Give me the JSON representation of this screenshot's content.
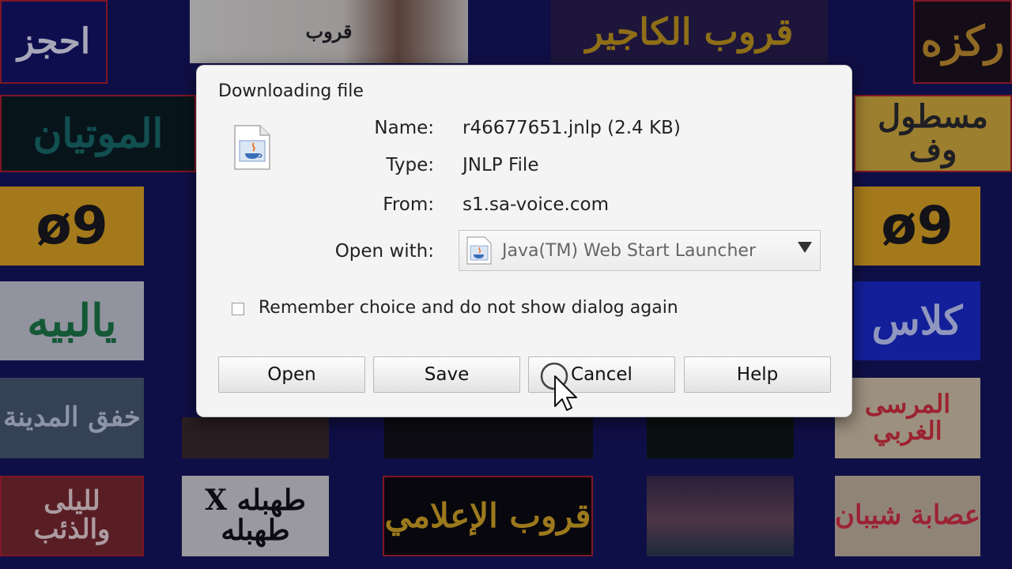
{
  "background_tiles": [
    {
      "text": "احجز",
      "color": "#e8e8f8",
      "bg": "#141466"
    },
    {
      "text": "قروب",
      "color": "#222222",
      "bg": "#d9d6cc"
    },
    {
      "text": "قروب الكاجير",
      "color": "#c59a18",
      "bg": "#2a1e4a"
    },
    {
      "text": "ركزه",
      "color": "#c8932a",
      "bg": "#1c1218"
    },
    {
      "text": "الموتيان",
      "color": "#1a6e68",
      "bg": "#0a1e1e"
    },
    {
      "text": "مسطول وف",
      "color": "#2a2a2a",
      "bg": "#d8b03a"
    },
    {
      "text": "ø9",
      "color": "#1a1a1a",
      "bg": "#e3a81e"
    },
    {
      "text": "ø9",
      "color": "#1a1a1a",
      "bg": "#e3a81e"
    },
    {
      "text": "يالبيه",
      "color": "#1d7a42",
      "bg": "#c9ccd4"
    },
    {
      "text": "كلاس",
      "color": "#c8d2ff",
      "bg": "#1a2ccc"
    },
    {
      "text": "خفق المدينة",
      "color": "#c4cde0",
      "bg": "#4a5a6e"
    },
    {
      "text": "المرسى الغربي",
      "color": "#d8303a",
      "bg": "#d8c8a8"
    },
    {
      "text": "لليلى والذئب",
      "color": "#f0d8d8",
      "bg": "#7a2a2a"
    },
    {
      "text": "طهبله X طهبله",
      "color": "#111111",
      "bg": "#d4d4d4"
    },
    {
      "text": "قروب الإعلامي",
      "color": "#d8a820",
      "bg": "#0a0a0a"
    },
    {
      "text": "عصابة شيبان",
      "color": "#d83040",
      "bg": "#c8b8a0"
    }
  ],
  "dialog": {
    "title": "Downloading file",
    "name_label": "Name:",
    "name_value": "r46677651.jnlp (2.4 KB)",
    "type_label": "Type:",
    "type_value": "JNLP File",
    "from_label": "From:",
    "from_value": "s1.sa-voice.com",
    "open_with_label": "Open with:",
    "open_with_value": "Java(TM) Web Start Launcher",
    "remember_label": "Remember choice and do not show dialog again",
    "remember_checked": false,
    "buttons": {
      "open": "Open",
      "save": "Save",
      "cancel": "Cancel",
      "help": "Help"
    }
  },
  "icons": {
    "file": "java-file-icon",
    "launcher": "java-launcher-icon",
    "dropdown": "chevron-down-icon",
    "cursor": "mouse-pointer-icon"
  },
  "colors": {
    "page_background": "#15155a",
    "tile_border": "#b0202a",
    "dialog_background": "#f4f4f4"
  }
}
